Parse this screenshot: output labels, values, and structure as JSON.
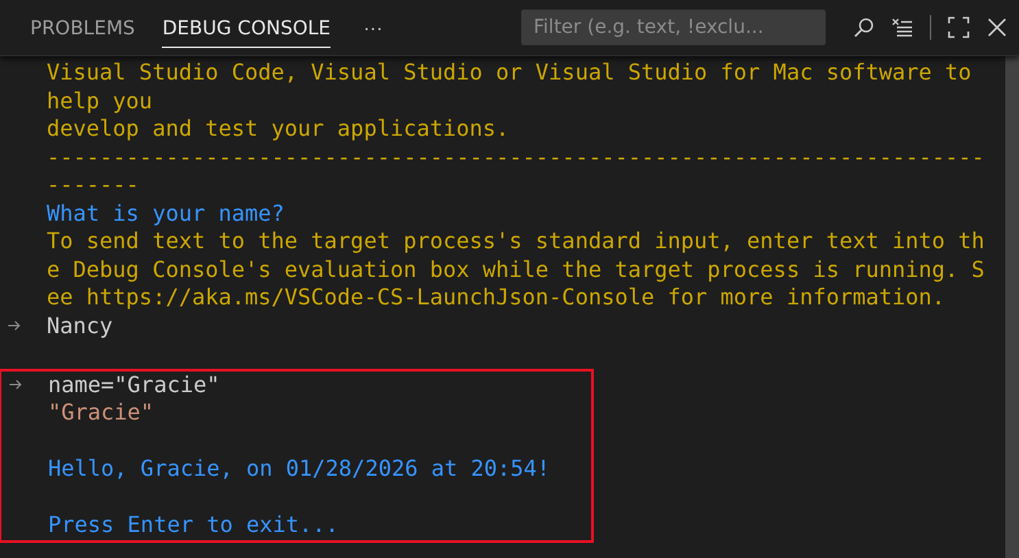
{
  "tabs": [
    {
      "label": "PROBLEMS",
      "selected": false
    },
    {
      "label": "DEBUG CONSOLE",
      "selected": true
    }
  ],
  "more": "···",
  "filter": {
    "placeholder": "Filter (e.g. text, !exclu..."
  },
  "console": {
    "lines": [
      {
        "kind": "output",
        "text": "Visual Studio Code, Visual Studio or Visual Studio for Mac software to"
      },
      {
        "kind": "output",
        "text": "help you"
      },
      {
        "kind": "output",
        "text": "develop and test your applications."
      },
      {
        "kind": "output",
        "text": "-----------------------------------------------------------------------"
      },
      {
        "kind": "output",
        "text": "-------"
      },
      {
        "kind": "info",
        "text": "What is your name?"
      },
      {
        "kind": "output",
        "text": "To send text to the target process's standard input, enter text into th"
      },
      {
        "kind": "output",
        "text": "e Debug Console's evaluation box while the target process is running. S"
      },
      {
        "kind": "output",
        "text": "ee https://aka.ms/VSCode-CS-LaunchJson-Console for more information."
      },
      {
        "kind": "input",
        "text": "Nancy"
      },
      {
        "kind": "blank"
      }
    ]
  },
  "highlight": {
    "lines": [
      {
        "kind": "input",
        "text": "name=\"Gracie\""
      },
      {
        "kind": "value",
        "text": "\"Gracie\""
      },
      {
        "kind": "blank"
      },
      {
        "kind": "info",
        "text": "Hello, Gracie, on 01/28/2026 at 20:54!"
      },
      {
        "kind": "blank"
      },
      {
        "kind": "info",
        "text": "Press Enter to exit..."
      }
    ]
  }
}
